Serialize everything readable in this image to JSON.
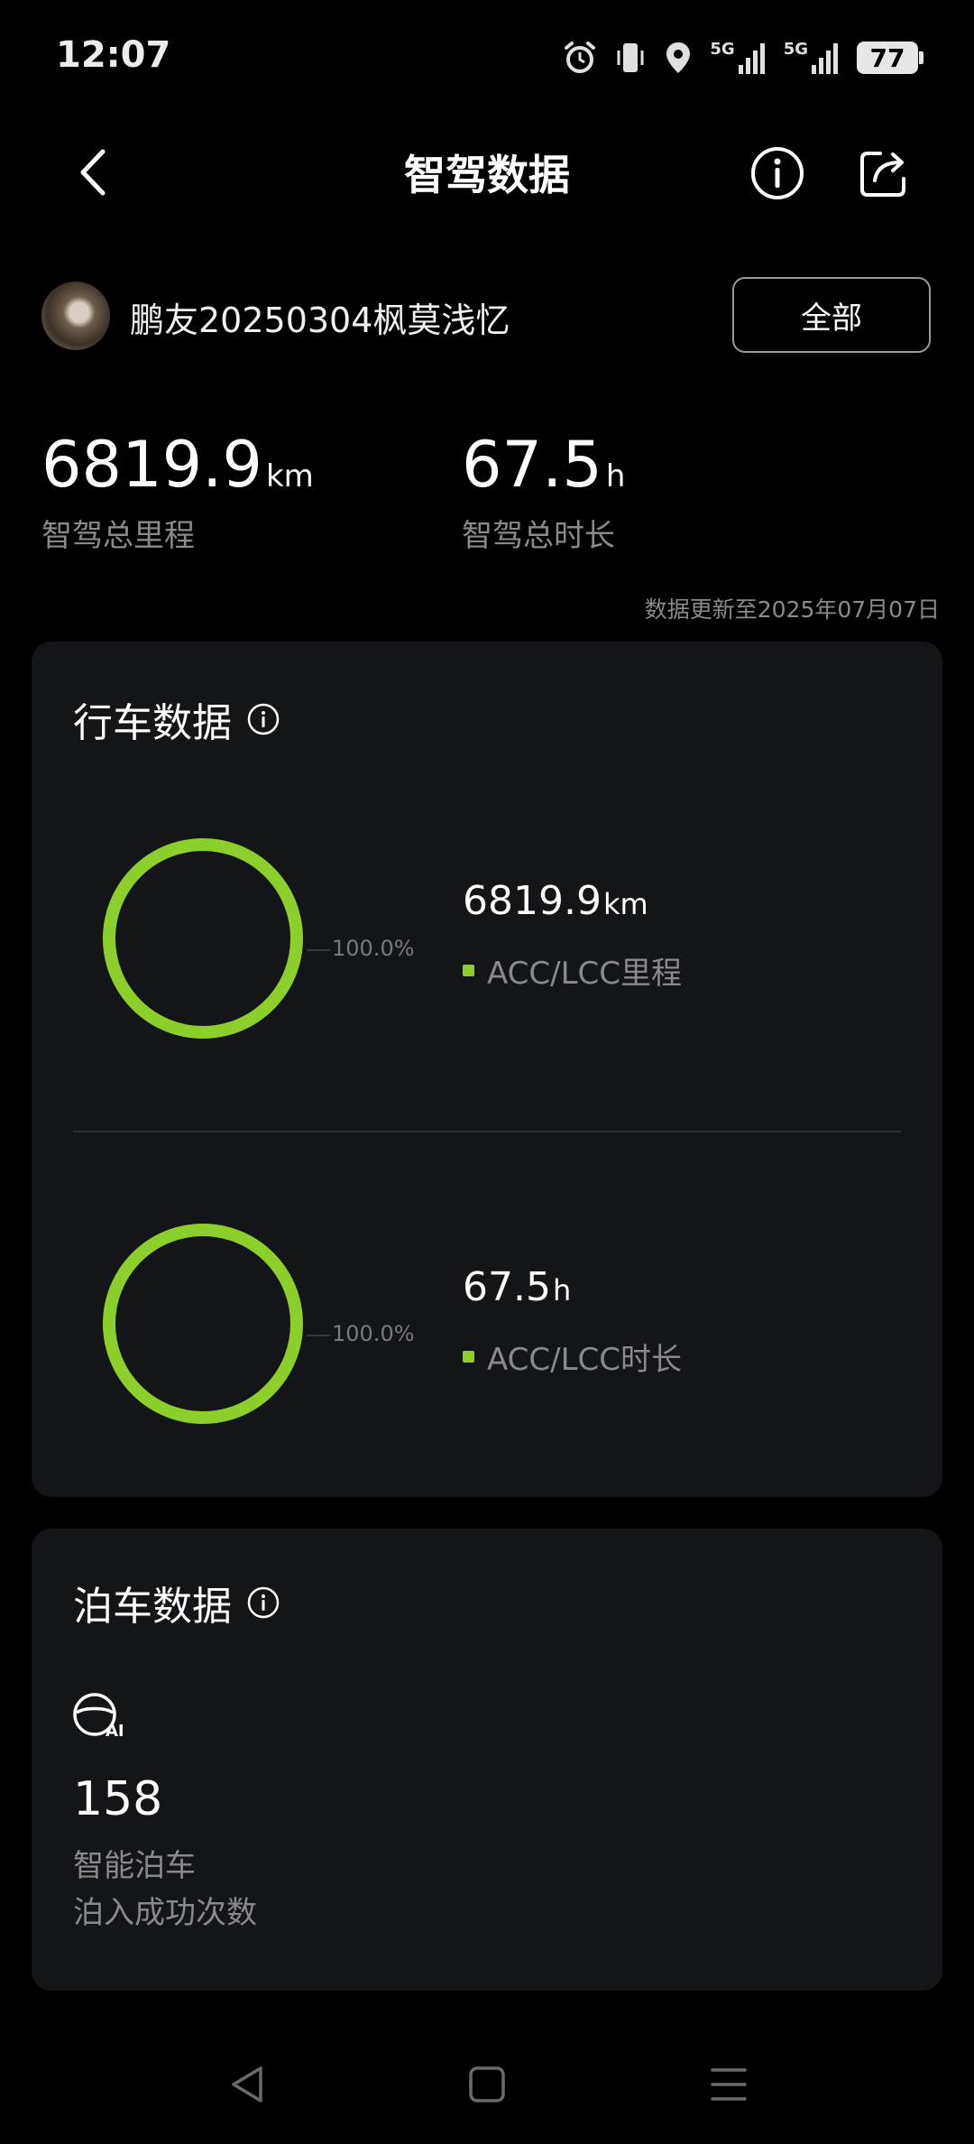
{
  "status_bar": {
    "time": "12:07",
    "signal1_label": "5G",
    "signal2_label": "5G",
    "battery": "77"
  },
  "header": {
    "title": "智驾数据"
  },
  "user": {
    "name": "鹏友20250304枫莫浅忆",
    "filter_label": "全部"
  },
  "summary": {
    "total_distance_value": "6819.9",
    "total_distance_unit": "km",
    "total_distance_label": "智驾总里程",
    "total_time_value": "67.5",
    "total_time_unit": "h",
    "total_time_label": "智驾总时长",
    "updated_text": "数据更新至2025年07月07日"
  },
  "driving_card": {
    "title": "行车数据",
    "items": [
      {
        "percent": "100.0%",
        "value": "6819.9",
        "unit": "km",
        "legend": "ACC/LCC里程",
        "share": 1.0
      },
      {
        "percent": "100.0%",
        "value": "67.5",
        "unit": "h",
        "legend": "ACC/LCC时长",
        "share": 1.0
      }
    ]
  },
  "parking_card": {
    "title": "泊车数据",
    "icon": "ai-steering-wheel-icon",
    "value": "158",
    "label_line1": "智能泊车",
    "label_line2": "泊入成功次数"
  },
  "colors": {
    "accent_green": "#8ccf2a",
    "card_bg": "#141518",
    "secondary_text": "#8a8a8a"
  }
}
